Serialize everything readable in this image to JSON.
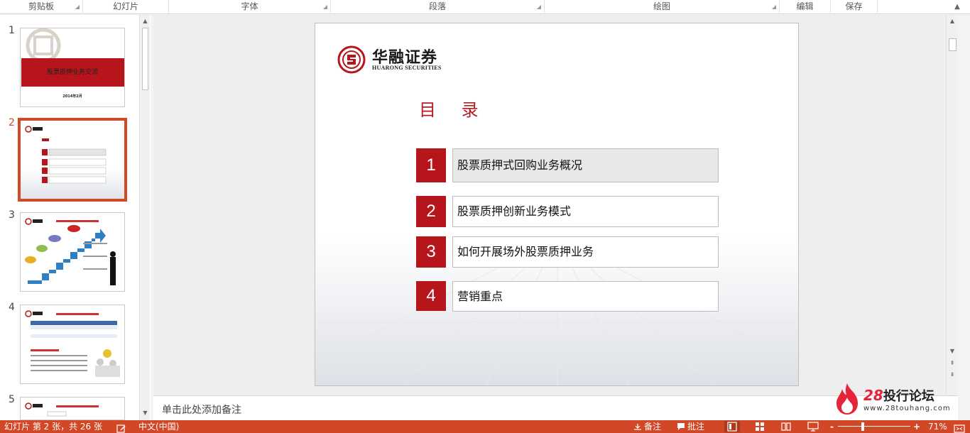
{
  "ribbon": {
    "groups": [
      {
        "label": "剪贴板",
        "launcher": true
      },
      {
        "label": "幻灯片",
        "launcher": false
      },
      {
        "label": "字体",
        "launcher": true
      },
      {
        "label": "段落",
        "launcher": true
      },
      {
        "label": "绘图",
        "launcher": true
      },
      {
        "label": "编辑",
        "launcher": false
      },
      {
        "label": "保存",
        "launcher": false
      }
    ],
    "collapse_icon": "chevron-up-icon"
  },
  "thumbnails": {
    "numbers": [
      "1",
      "2",
      "3",
      "4",
      "5"
    ],
    "selected": "2",
    "slide1": {
      "title": "股票质押业务交流",
      "date": "2014年2月"
    }
  },
  "slide": {
    "logo_cn": "华融证券",
    "logo_en": "HUARONG SECURITIES",
    "toc_title": "目 录",
    "items": [
      {
        "num": "1",
        "text": "股票质押式回购业务概况"
      },
      {
        "num": "2",
        "text": "股票质押创新业务模式"
      },
      {
        "num": "3",
        "text": "如何开展场外股票质押业务"
      },
      {
        "num": "4",
        "text": "营销重点"
      }
    ],
    "brand_color": "#b5151b"
  },
  "notes": {
    "placeholder": "单击此处添加备注"
  },
  "watermark": {
    "logo_num": "28",
    "logo_cn": "投行论坛",
    "url": "www.28touhang.com"
  },
  "statusbar": {
    "slide_info": "幻灯片 第 2 张，共 26 张",
    "language": "中文(中国)",
    "notes_label": "备注",
    "comments_label": "批注",
    "zoom_minus": "-",
    "zoom_plus": "+",
    "zoom_percent": "71%",
    "zoom_level": 0.71,
    "accent_color": "#d24726"
  }
}
